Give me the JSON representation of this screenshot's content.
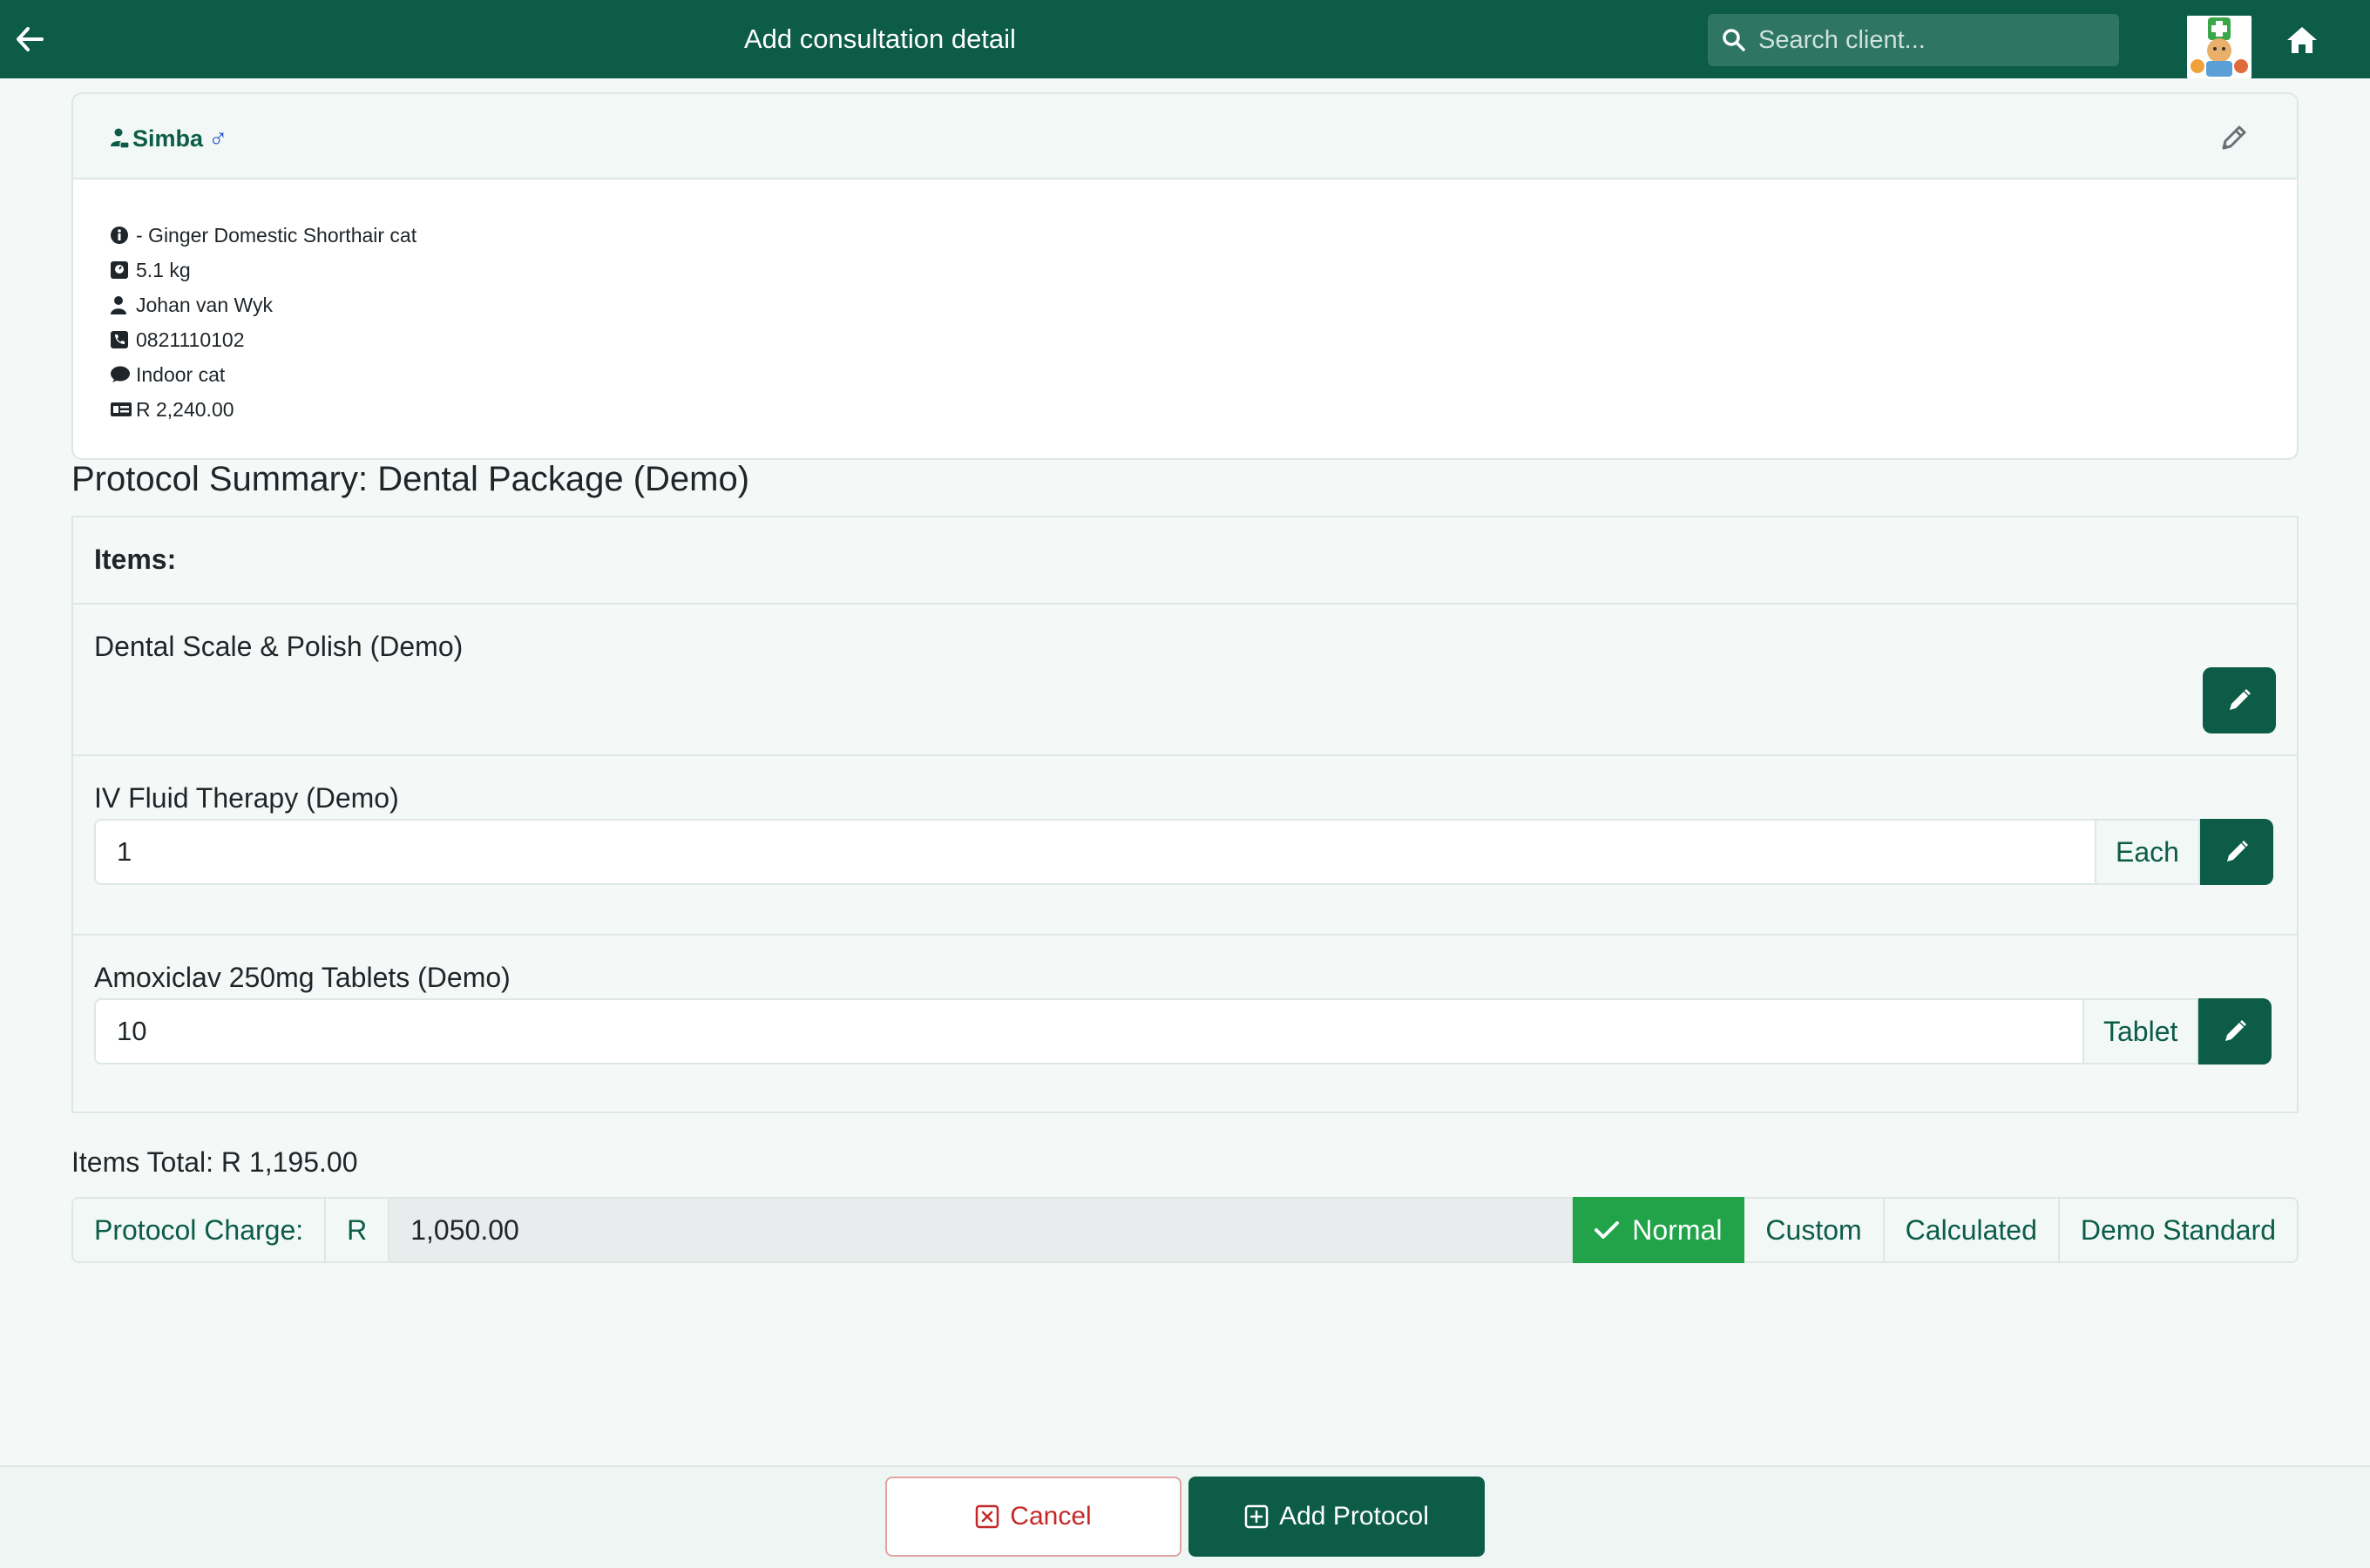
{
  "header": {
    "title": "Add consultation detail",
    "search_placeholder": "Search client...",
    "back_icon": "arrow-left-icon",
    "home_icon": "home-icon",
    "brand_color": "#0c5c47"
  },
  "patient": {
    "name": "Simba",
    "sex_symbol": "♂",
    "details": [
      {
        "icon": "info-icon",
        "text": "- Ginger Domestic Shorthair cat"
      },
      {
        "icon": "weight-icon",
        "text": "5.1 kg"
      },
      {
        "icon": "user-icon",
        "text": "Johan van Wyk"
      },
      {
        "icon": "phone-icon",
        "text": "0821110102"
      },
      {
        "icon": "comment-icon",
        "text": "Indoor cat"
      },
      {
        "icon": "money-icon",
        "text": "R 2,240.00"
      }
    ]
  },
  "summary": {
    "title": "Protocol Summary: Dental Package (Demo)",
    "items_heading": "Items:",
    "items": [
      {
        "name": "Dental Scale & Polish (Demo)"
      },
      {
        "name": "IV Fluid Therapy (Demo)",
        "quantity": "1",
        "unit": "Each"
      },
      {
        "name": "Amoxiclav 250mg Tablets (Demo)",
        "quantity": "10",
        "unit": "Tablet"
      }
    ]
  },
  "totals": {
    "items_total": "Items Total: R 1,195.00",
    "charge_label": "Protocol Charge:",
    "currency": "R",
    "charge_value": "1,050.00",
    "modes": [
      "Normal",
      "Custom",
      "Calculated",
      "Demo Standard"
    ],
    "active_mode": "Normal",
    "active_color": "#22a34a"
  },
  "footer": {
    "cancel_label": "Cancel",
    "add_label": "Add Protocol"
  }
}
